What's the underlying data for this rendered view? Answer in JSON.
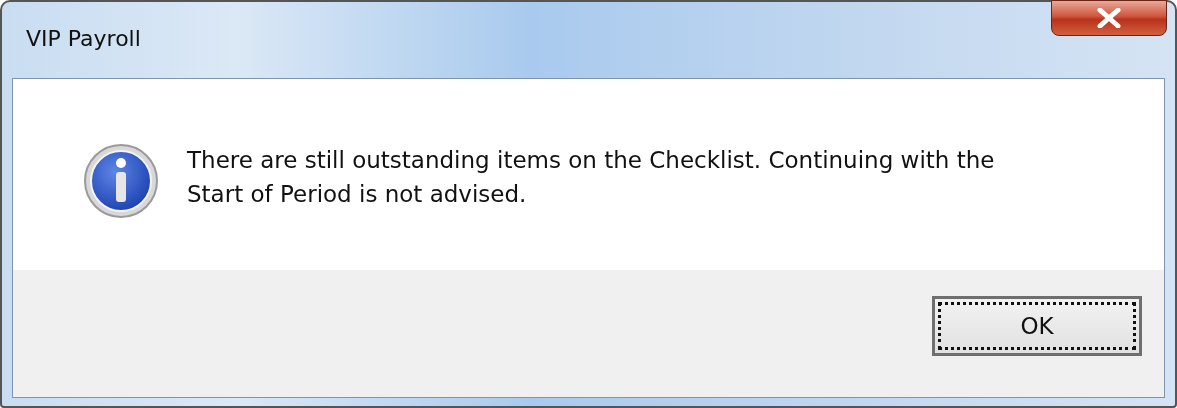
{
  "window": {
    "title": "VIP Payroll"
  },
  "message": {
    "kind": "info",
    "text": "There are still outstanding items on the Checklist. Continuing with the Start of Period is not advised."
  },
  "buttons": [
    {
      "label": "OK",
      "focused": true
    }
  ]
}
